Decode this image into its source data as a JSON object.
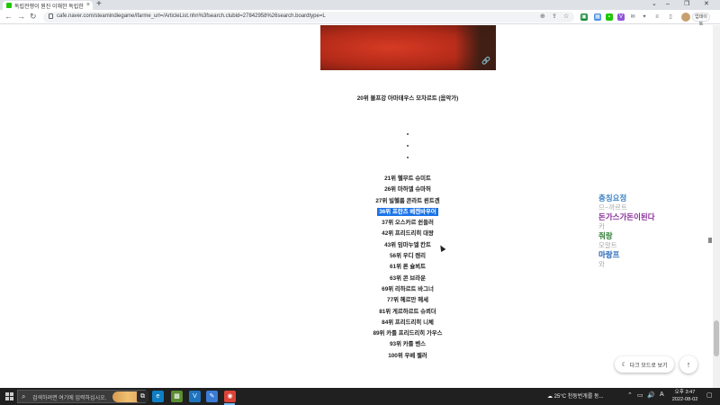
{
  "browser": {
    "tab_title": "독립전쟁이 뭔진 이해한 독립한",
    "tab_close": "×",
    "new_tab": "+",
    "window_controls": [
      "⌄",
      "–",
      "❐",
      "✕"
    ],
    "nav": {
      "back": "←",
      "forward": "→",
      "reload": "↻"
    },
    "url": "cafe.naver.com/steamindiegame/ifarme_url=/ArticleList.nhn%3fsearch.clubid=27842958%26search.boardtype=L",
    "omnibox_icons": [
      "⊕",
      "⇪",
      "☆"
    ],
    "update_label": "업데이트",
    "extensions": [
      {
        "name": "extension-green-icon",
        "glyph": "▣",
        "color": "#1a8b3c"
      },
      {
        "name": "extension-photo-icon",
        "glyph": "▦",
        "color": "#4a90e2"
      },
      {
        "name": "extension-box-icon",
        "glyph": "▪",
        "color": "#1ec800"
      },
      {
        "name": "extension-v-icon",
        "glyph": "V",
        "color": "#9155d8"
      },
      {
        "name": "extension-mail-icon",
        "glyph": "✉",
        "color": "#5f6368"
      },
      {
        "name": "extension-puzzle-icon",
        "glyph": "✦",
        "color": "#5f6368"
      },
      {
        "name": "extension-list-icon",
        "glyph": "≡",
        "color": "#5f6368"
      },
      {
        "name": "extension-split-icon",
        "glyph": "▯",
        "color": "#5f6368"
      }
    ]
  },
  "article": {
    "link_icon": "🔗",
    "caption": "20위 볼프강 아마데우스 모차르트 (음악가)",
    "ellipsis_dots": [
      "·",
      "·",
      "·"
    ],
    "ranks": [
      {
        "text": "21위 헬무트 슈미트",
        "selected": false
      },
      {
        "text": "26위 마하엘 슈마허",
        "selected": false
      },
      {
        "text": "27위 빌헬름 콘라트 뢴트겐",
        "selected": false
      },
      {
        "text": "36위 프란츠 베켄바우어",
        "selected": true
      },
      {
        "text": "37위 오스카르 쉰들러",
        "selected": false
      },
      {
        "text": "42위 프리드리히 대왕",
        "selected": false
      },
      {
        "text": "43위 임마누엘 칸트",
        "selected": false
      },
      {
        "text": "56위 우디 렌리",
        "selected": false
      },
      {
        "text": "61위 론 슐뵈트",
        "selected": false
      },
      {
        "text": "63위 콘 브라운",
        "selected": false
      },
      {
        "text": "69위 리하르트 바그너",
        "selected": false
      },
      {
        "text": "77위 헤르만 헤세",
        "selected": false
      },
      {
        "text": "81위 게르하르트 슈뢰더",
        "selected": false
      },
      {
        "text": "84위 프리드리히 니체",
        "selected": false
      },
      {
        "text": "89위 카를 프리드리히 가우스",
        "selected": false
      },
      {
        "text": "93위 카를 벤스",
        "selected": false
      },
      {
        "text": "100위 우베 젤러",
        "selected": false
      }
    ]
  },
  "side_list": [
    {
      "text": "충칭요정",
      "color": "#3b82c4",
      "kind": "word"
    },
    {
      "text": "므~까르트",
      "color": "#aaaaaa",
      "kind": "sub"
    },
    {
      "text": "돈가스가돈이된다",
      "color": "#8a2a9b",
      "kind": "word"
    },
    {
      "text": "카",
      "color": "#aaaaaa",
      "kind": "sub"
    },
    {
      "text": "줘랑",
      "color": "#2f7d32",
      "kind": "word"
    },
    {
      "text": "모알트",
      "color": "#aaaaaa",
      "kind": "sub"
    },
    {
      "text": "마랑프",
      "color": "#1a5fb4",
      "kind": "word"
    },
    {
      "text": "와",
      "color": "#aaaaaa",
      "kind": "sub"
    }
  ],
  "floating": {
    "dark_mode_icon": "☾",
    "dark_mode_label": "다크 모드로 보기",
    "top_icon": "↑"
  },
  "taskbar": {
    "search_icon": "⌕",
    "search_placeholder": "검색하려면 여기에 입력하십시오.",
    "apps": [
      {
        "name": "task-view-icon",
        "glyph": "⧉",
        "color": "#2b2b2b"
      },
      {
        "name": "edge-icon",
        "glyph": "e",
        "color": "#0f7fc4"
      },
      {
        "name": "minecraft-icon",
        "glyph": "▩",
        "color": "#5b8c32"
      },
      {
        "name": "vscode-icon",
        "glyph": "V",
        "color": "#1e73be"
      },
      {
        "name": "notepad-icon",
        "glyph": "✎",
        "color": "#3a7bd5"
      },
      {
        "name": "chrome-icon",
        "glyph": "◉",
        "color": "#db4437"
      }
    ],
    "weather": "☁ 25°C 천둥번개를 동...",
    "sys_icons": [
      "⌃",
      "▭",
      "🔊",
      "A"
    ],
    "time": "오후 3:47",
    "date": "2022-08-02",
    "notif_icon": "▢"
  },
  "colors": {
    "selection": "#1a73e8",
    "taskbar_bg": "#202020"
  }
}
